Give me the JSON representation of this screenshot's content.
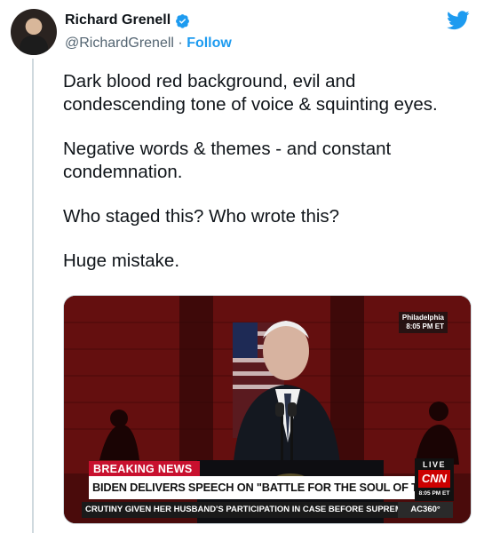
{
  "author": {
    "name": "Richard Grenell",
    "handle": "@RichardGrenell",
    "separator": "·",
    "follow_label": "Follow"
  },
  "tweet": {
    "paragraphs": [
      "Dark blood red background, evil and condescending tone of voice & squinting eyes.",
      "Negative words & themes - and constant condemnation.",
      "Who staged this? Who wrote this?",
      "Huge mistake."
    ]
  },
  "media": {
    "location_city": "Philadelphia",
    "location_time": "8:05 PM ET",
    "breaking_label": "BREAKING NEWS",
    "headline": "BIDEN DELIVERS SPEECH ON \"BATTLE FOR THE SOUL OF THE NATION\"",
    "live_label": "LIVE",
    "network_logo": "CNN",
    "network_time": "8:05 PM ET",
    "ticker": "CRUTINY GIVEN HER HUSBAND'S PARTICIPATION IN CASE BEFORE SUPREME",
    "show_label": "AC360°"
  },
  "colors": {
    "accent": "#1d9bf0",
    "background_red": "#6b0f0f",
    "breaking_red": "#c8102e"
  }
}
